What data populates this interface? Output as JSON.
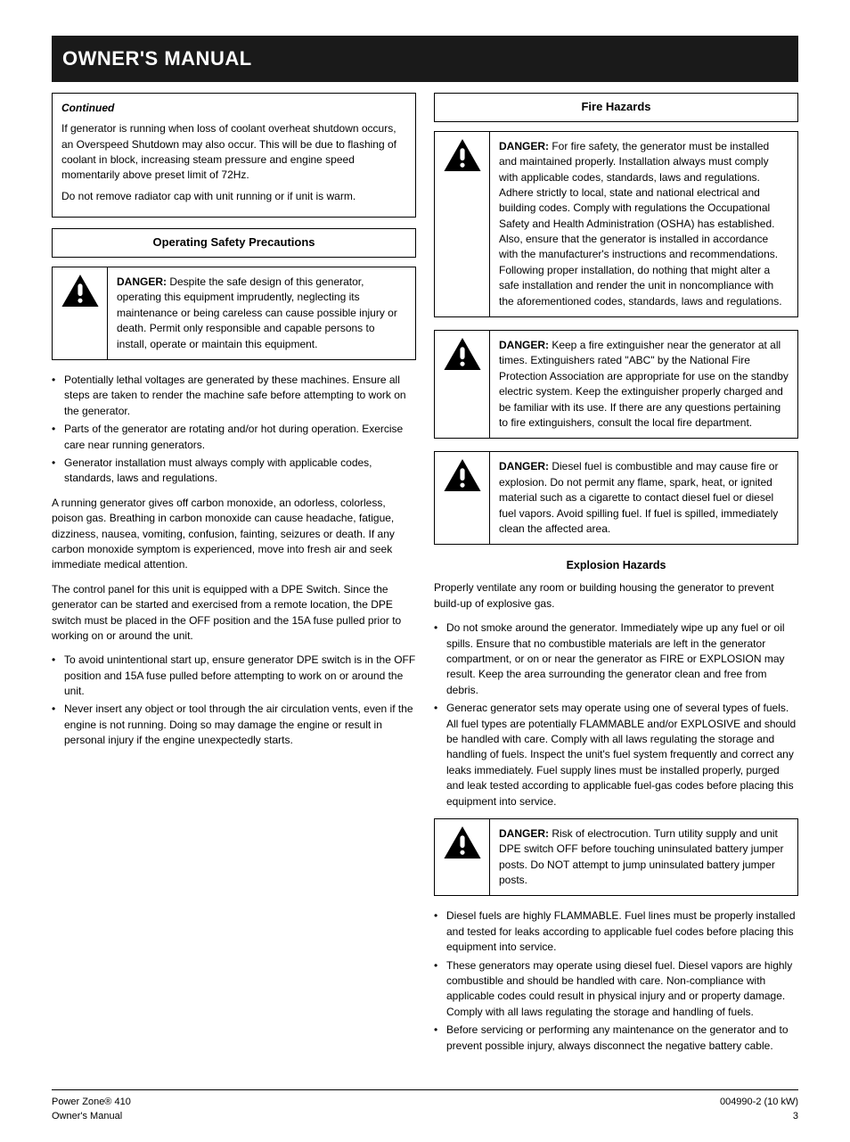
{
  "banner": {
    "title": "OWNER'S MANUAL"
  },
  "intro": {
    "p1a": "Continued",
    "p1b": "If generator is running when loss of coolant overheat shutdown occurs, an Overspeed Shutdown may also occur. This will be due to flashing of coolant in block, increasing steam pres­sure and engine speed momentarily above preset limit of 72Hz.",
    "p2": "Do not remove radiator cap with unit running or if unit is warm."
  },
  "left": {
    "hdr": "Operating Safety Precautions",
    "warn": {
      "lead": "DANGER:",
      "body": " Despite the safe design of this generator, operating this equipment imprudently, neglecting its maintenance or being careless can cause possible injury or death. Permit only responsible and capable persons to install, operate or maintain this equipment."
    },
    "bullets": [
      "Potentially lethal voltages are generated by these machines. Ensure all steps are taken to render the machine safe before attempting to work on the generator.",
      "Parts of the generator are rotating and/or hot during opera­tion. Exercise care near running generators.",
      "Generator installation must always comply with applicable codes, standards, laws and regulations."
    ],
    "para1": "A running generator gives off carbon monoxide, an odorless, colorless, poison gas. Breathing in carbon monoxide can cause headache, fatigue, dizziness, nausea, vomiting, confusion, faint­ing, seizures or death. If any carbon monoxide symptom is expe­rienced, move into fresh air and seek immediate medical attention.",
    "para2": "The control panel for this unit is equipped with a DPE Switch. Since the generator can be started and exercised from a remote location, the DPE switch must be placed in the OFF position and the 15A fuse pulled prior to working on or around the unit.",
    "bullets2": [
      "To avoid unintentional start up, ensure generator DPE switch is in the OFF position and 15A fuse pulled before attempting to work on or around the unit.",
      "Never insert any object or tool through the air circulation vents, even if the engine is not running. Doing so may dam­age the engine or result in personal injury if the engine unex­pectedly starts."
    ]
  },
  "right": {
    "hdr": "Fire Hazards",
    "warn1": {
      "lead": "DANGER:",
      "body": " For fire safety, the generator must be in­stalled and maintained properly. Installation always must comply with applicable codes, standards, laws and regula­tions. Adhere strictly to local, state and national electrical and building codes. Comply with regulations the Occupa­tional Safety and Health Administration (OSHA) has es­tablished. Also, ensure that the generator is installed in accordance with the manufacturer's instructions and rec­ommendations. Following proper installation, do nothing that might alter a safe installation and render the unit in noncompliance with the aforementioned codes, standards, laws and regulations."
    },
    "warn2": {
      "lead": "DANGER:",
      "body": " Keep a fire extinguisher near the generator at all times. Extinguishers rated \"ABC\" by the National Fire Protection Association are appropriate for use on the standby electric system. Keep the extinguisher properly charged and be familiar with its use. If there are any ques­tions pertaining to fire extinguishers, consult the local fire department."
    },
    "warn3": {
      "lead": "DANGER:",
      "body": " Diesel fuel is combustible and may cause fire or explosion. Do not permit any flame, spark, heat, or ignited material such as a cigarette to contact diesel fuel or diesel fuel vapors. Avoid spilling fuel. If fuel is spilled, im­mediately clean the affected area."
    },
    "sub_hdr": "Explosion Hazards",
    "ex_para": "Properly ventilate any room or building housing the generator to prevent build-up of explosive gas.",
    "ex_bullets": [
      "Do not smoke around the generator. Immediately wipe up any fuel or oil spills. Ensure that no combustible materials are left in the generator compartment, or on or near the generator as FIRE or EXPLOSION may result. Keep the area surrounding the generator clean and free from debris.",
      "Generac generator sets may operate using one of several types of fuels. All fuel types are potentially FLAMMABLE and/or EXPLOSIVE and should be handled with care. Comply with all laws regulating the storage and handling of fuels. Inspect the unit's fuel system frequently and correct any leaks imme­diately. Fuel supply lines must be installed properly, purged and leak tested according to applicable fuel-gas codes before placing this equipment into service."
    ],
    "warn4": {
      "lead": "DANGER:",
      "body": " Risk of electrocution. Turn utility supply and unit DPE switch OFF before touching uninsulated bat­tery jumper posts. Do NOT attempt to jump uninsulated bat­tery jumper posts."
    },
    "after_list": [
      "Diesel fuels are highly FLAMMABLE. Fuel lines must be prop­erly installed and tested for leaks according to applicable fuel codes before placing this equipment into service.",
      "These generators may operate using diesel fuel. Diesel vapors are highly combustible and should be handled with care. Non-compliance with applicable codes could result in physi­cal injury and or property damage. Comply with all laws regu­lating the storage and handling of fuels.",
      "Before servicing or performing any maintenance on the gen­erator and to prevent possible injury, always disconnect the negative battery cable."
    ]
  },
  "footer": {
    "left1": "Power Zone® 410",
    "left2": "Owner's Manual",
    "right1": "004990-2 (10 kW)",
    "right2": "3"
  }
}
